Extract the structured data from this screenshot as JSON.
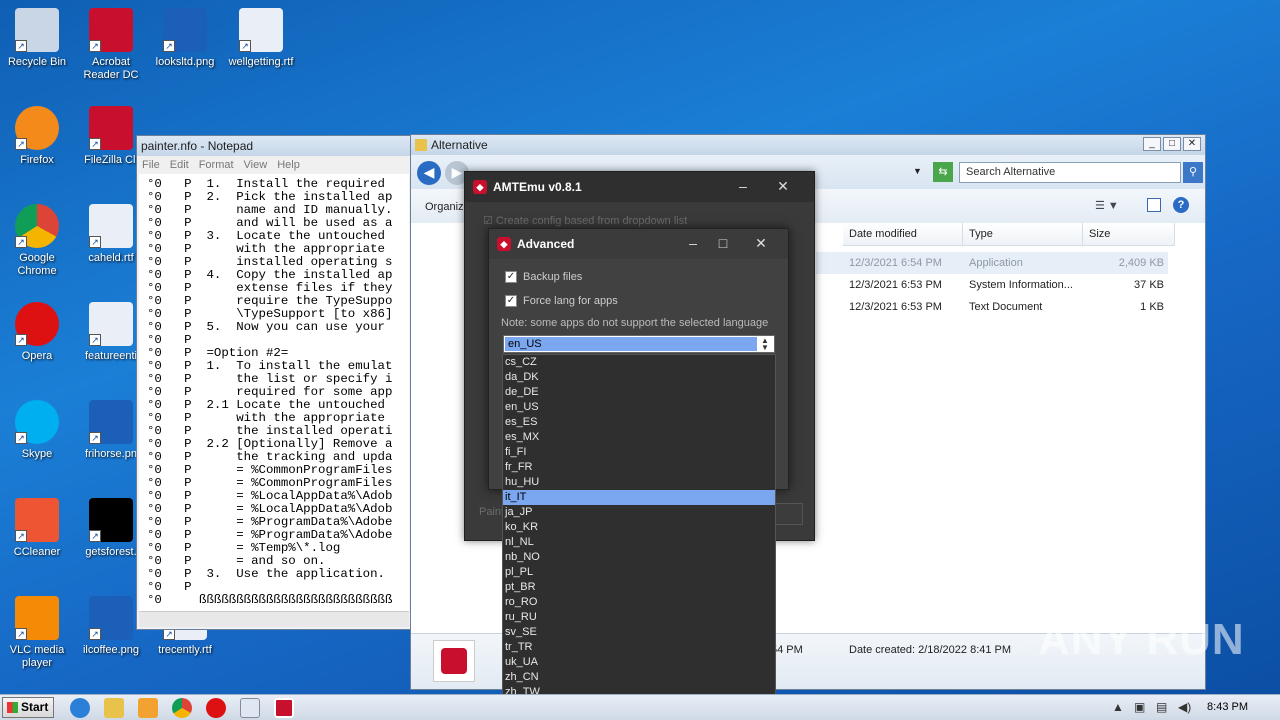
{
  "desktop": {
    "icons": [
      {
        "label": "Recycle Bin",
        "icon": "recycle-bin-icon"
      },
      {
        "label": "Acrobat Reader DC",
        "icon": "acrobat-icon"
      },
      {
        "label": "looksltd.png",
        "icon": "image-file-icon"
      },
      {
        "label": "wellgetting.rtf",
        "icon": "word-doc-icon"
      },
      {
        "label": "Firefox",
        "icon": "firefox-icon"
      },
      {
        "label": "FileZilla Cli",
        "icon": "filezilla-icon"
      },
      {
        "label": "Google Chrome",
        "icon": "chrome-icon"
      },
      {
        "label": "caheld.rtf",
        "icon": "word-doc-icon"
      },
      {
        "label": "Opera",
        "icon": "opera-icon"
      },
      {
        "label": "featureenti",
        "icon": "word-doc-icon"
      },
      {
        "label": "Skype",
        "icon": "skype-icon"
      },
      {
        "label": "frihorse.pn",
        "icon": "image-file-icon"
      },
      {
        "label": "CCleaner",
        "icon": "ccleaner-icon"
      },
      {
        "label": "getsforest.",
        "icon": "image-file-icon"
      },
      {
        "label": "VLC media player",
        "icon": "vlc-icon"
      },
      {
        "label": "ilcoffee.png",
        "icon": "image-file-icon"
      },
      {
        "label": "trecently.rtf",
        "icon": "word-doc-icon"
      }
    ]
  },
  "notepad": {
    "title": "painter.nfo - Notepad",
    "menu": [
      "File",
      "Edit",
      "Format",
      "View",
      "Help"
    ],
    "lines": [
      "°0   P  1.  Install the required",
      "°0   P  2.  Pick the installed ap",
      "°0   P      name and ID manually.",
      "°0   P      and will be used as a",
      "°0   P  3.  Locate the untouched",
      "°0   P      with the appropriate",
      "°0   P      installed operating s",
      "°0   P  4.  Copy the installed ap",
      "°0   P      extense files if they",
      "°0   P      require the TypeSuppo",
      "°0   P      \\TypeSupport [to x86]",
      "°0   P  5.  Now you can use your",
      "°0   P",
      "°0   P  =Option #2=",
      "°0   P  1.  To install the emulat",
      "°0   P      the list or specify i",
      "°0   P      required for some app",
      "°0   P  2.1 Locate the untouched",
      "°0   P      with the appropriate",
      "°0   P      the installed operati",
      "°0   P  2.2 [Optionally] Remove a",
      "°0   P      the tracking and upda",
      "°0   P      = %CommonProgramFiles",
      "°0   P      = %CommonProgramFiles",
      "°0   P      = %LocalAppData%\\Adob",
      "°0   P      = %LocalAppData%\\Adob",
      "°0   P      = %ProgramData%\\Adobe",
      "°0   P      = %ProgramData%\\Adobe",
      "°0   P      = %Temp%\\*.log",
      "°0   P      = and so on.",
      "°0   P  3.  Use the application.",
      "°0   P",
      "°0     ßßßßßßßßßßßßßßßßßßßßßßßßßß"
    ]
  },
  "explorer": {
    "title": "Alternative",
    "search_placeholder": "Search Alternative",
    "organize": "Organize",
    "columns": [
      "Date modified",
      "Type",
      "Size"
    ],
    "rows": [
      {
        "date": "12/3/2021 6:54 PM",
        "type": "Application",
        "size": "2,409 KB"
      },
      {
        "date": "12/3/2021 6:53 PM",
        "type": "System Information...",
        "size": "37 KB"
      },
      {
        "date": "12/3/2021 6:53 PM",
        "type": "Text Document",
        "size": "1 KB"
      }
    ],
    "details": {
      "partial_date": "54 PM",
      "date_created": "Date created: 2/18/2022 8:41 PM"
    }
  },
  "amtemu": {
    "title": "AMTEmu v0.8.1",
    "create_config": "Create config based from dropdown list",
    "footer_left": "Paint"
  },
  "advanced": {
    "title": "Advanced",
    "backup_files": "Backup files",
    "force_lang": "Force lang for apps",
    "note": "Note: some apps do not support the selected language",
    "selected": "en_US",
    "options": [
      "cs_CZ",
      "da_DK",
      "de_DE",
      "en_US",
      "es_ES",
      "es_MX",
      "fi_FI",
      "fr_FR",
      "hu_HU",
      "it_IT",
      "ja_JP",
      "ko_KR",
      "nl_NL",
      "nb_NO",
      "pl_PL",
      "pt_BR",
      "ro_RO",
      "ru_RU",
      "sv_SE",
      "tr_TR",
      "uk_UA",
      "zh_CN",
      "zh_TW"
    ],
    "highlighted": "it_IT"
  },
  "taskbar": {
    "start": "Start",
    "clock": "8:43 PM"
  },
  "watermark": "ANY RUN"
}
